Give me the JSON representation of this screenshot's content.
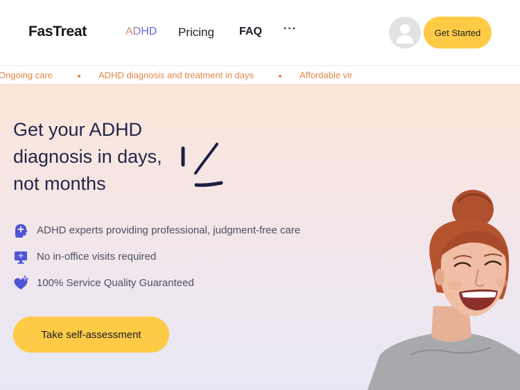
{
  "header": {
    "logo": "FasTreat",
    "nav": {
      "adhd": "ADHD",
      "pricing": "Pricing",
      "faq": "FAQ",
      "more": "···"
    },
    "get_started": "Get Started"
  },
  "ticker": {
    "items": [
      "nal Ongoing care",
      "ADHD diagnosis and treatment in days",
      "Affordable vir"
    ]
  },
  "hero": {
    "title_line1": "Get your ADHD",
    "title_line2": "diagnosis in days,",
    "title_line3": "not months",
    "features": [
      {
        "icon": "head-plus-icon",
        "text": "ADHD experts providing professional, judgment-free care"
      },
      {
        "icon": "monitor-icon",
        "text": "No in-office visits required"
      },
      {
        "icon": "heart-plus-icon",
        "text": "100% Service Quality Guaranteed"
      }
    ],
    "cta": "Take self-assessment"
  },
  "colors": {
    "accent_yellow": "#ffcb47",
    "ticker_orange": "#e2864a",
    "icon_blue": "#4f55d6",
    "title_navy": "#22264a"
  }
}
